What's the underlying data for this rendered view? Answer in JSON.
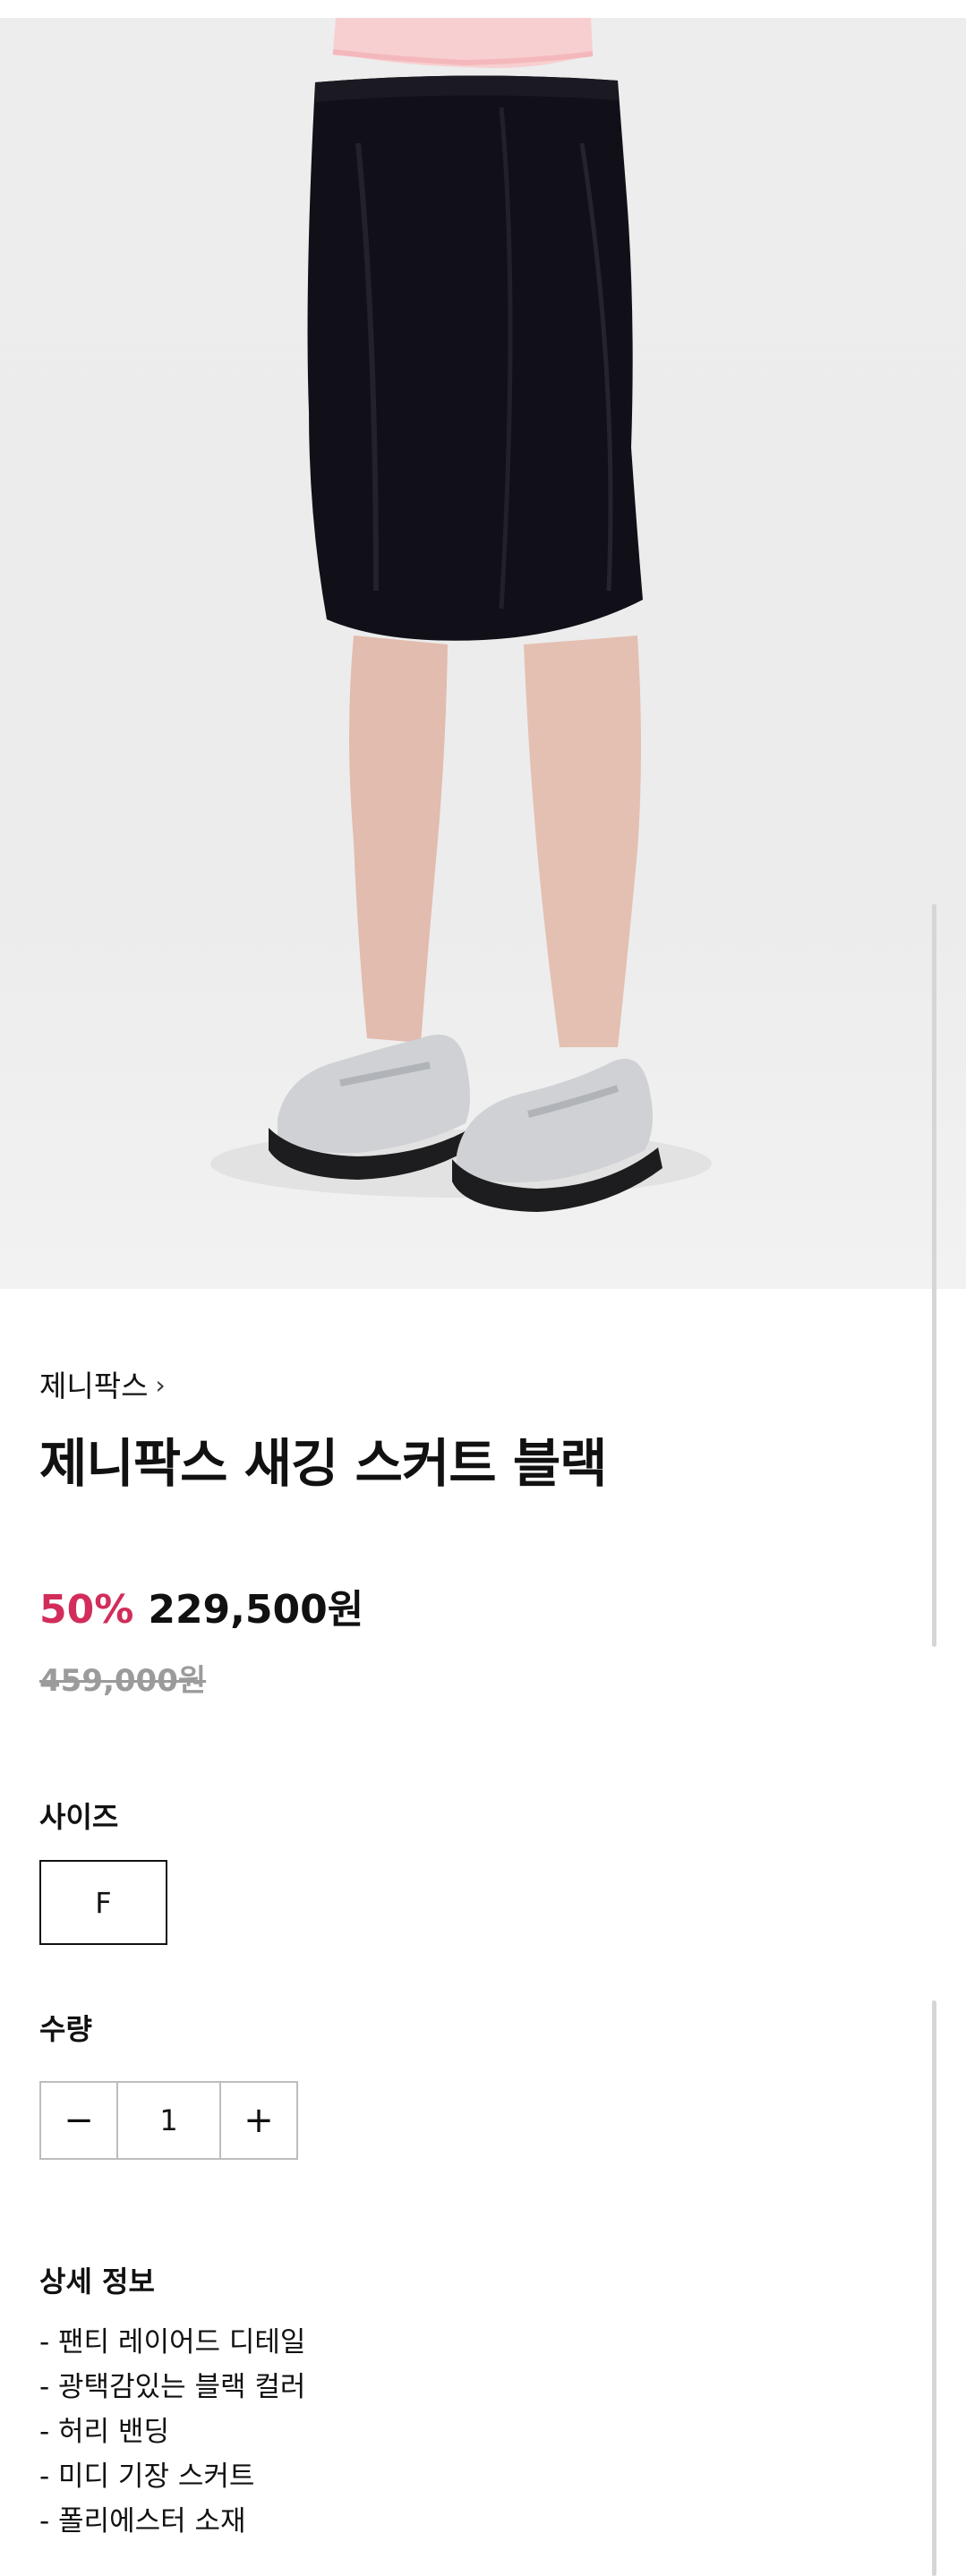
{
  "product": {
    "brand": "제니팍스",
    "brand_chevron": "›",
    "title": "제니팍스 새깅 스커트 블랙",
    "discount": "50%",
    "price": "229,500원",
    "original_price": "459,000원"
  },
  "options": {
    "size_label": "사이즈",
    "size_value": "F",
    "quantity_label": "수량",
    "quantity_minus": "−",
    "quantity_value": "1",
    "quantity_plus": "+"
  },
  "details": {
    "label": "상세 정보",
    "items": [
      "- 팬티 레이어드 디테일",
      "- 광택감있는 블랙 컬러",
      "- 허리 밴딩",
      "- 미디 기장 스커트",
      "- 폴리에스터 소재"
    ]
  },
  "colors": {
    "discount": "#d22d5a",
    "original_price": "#9b9b9b",
    "hero_background": "#ececec"
  }
}
